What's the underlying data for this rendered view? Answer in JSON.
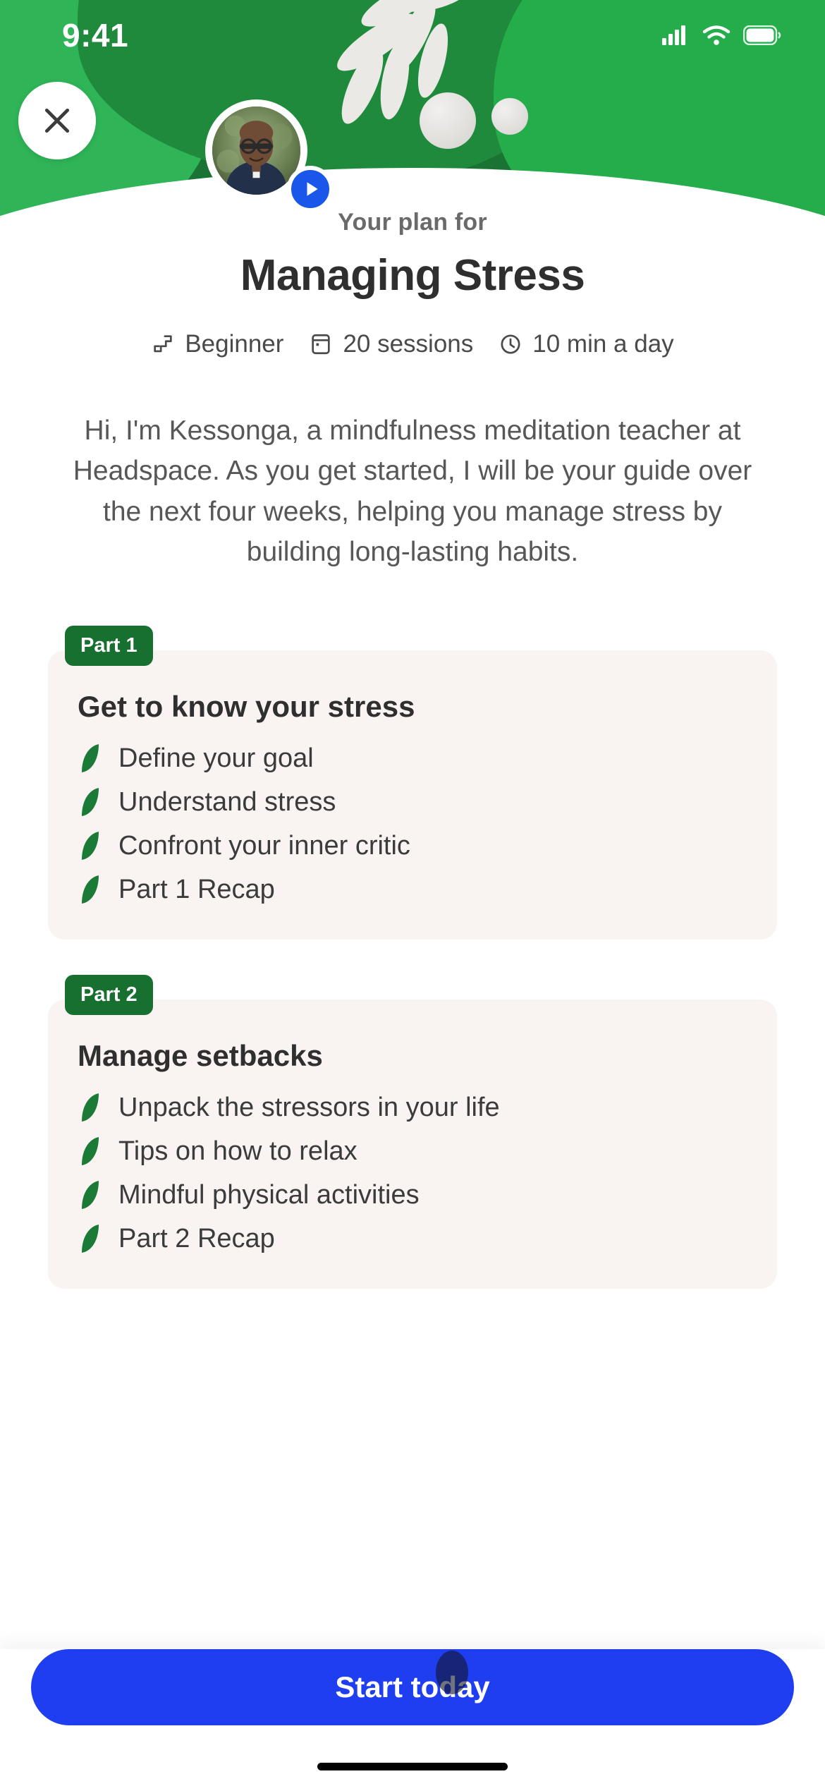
{
  "status_bar": {
    "time": "9:41",
    "cellular_icon": "cellular-signal-icon",
    "wifi_icon": "wifi-icon",
    "battery_icon": "battery-icon"
  },
  "hero": {
    "close_icon": "close-icon",
    "avatar_icon": "teacher-avatar",
    "play_icon": "play-icon",
    "background_color": "#1a7333",
    "accent_green": "#25ad4c",
    "decoration_fern": "fern-leaf-decoration",
    "decoration_spheres": "pebble-sphere-decoration"
  },
  "header": {
    "eyebrow": "Your plan for",
    "title": "Managing Stress"
  },
  "meta": [
    {
      "icon": "stairs-level-icon",
      "label": "Beginner"
    },
    {
      "icon": "sessions-card-icon",
      "label": "20 sessions"
    },
    {
      "icon": "clock-icon",
      "label": "10 min a day"
    }
  ],
  "description": "Hi, I'm Kessonga, a mindfulness meditation teacher at Headspace. As you get started, I will be your guide over the next four weeks, helping you manage stress by building long-lasting habits.",
  "parts": [
    {
      "badge": "Part 1",
      "title": "Get to know your stress",
      "lessons": [
        "Define your goal",
        "Understand stress",
        "Confront your inner critic",
        "Part 1 Recap"
      ]
    },
    {
      "badge": "Part 2",
      "title": "Manage setbacks",
      "lessons": [
        "Unpack the stressors in your life",
        "Tips on how to relax",
        "Mindful physical activities",
        "Part 2 Recap"
      ]
    }
  ],
  "footer": {
    "cta_label": "Start today",
    "cta_color": "#1f3ef0"
  },
  "colors": {
    "brand_green": "#17702f",
    "card_bg": "#f9f4f2",
    "leaf_green": "#1b7a35",
    "play_blue": "#1a56ea"
  }
}
